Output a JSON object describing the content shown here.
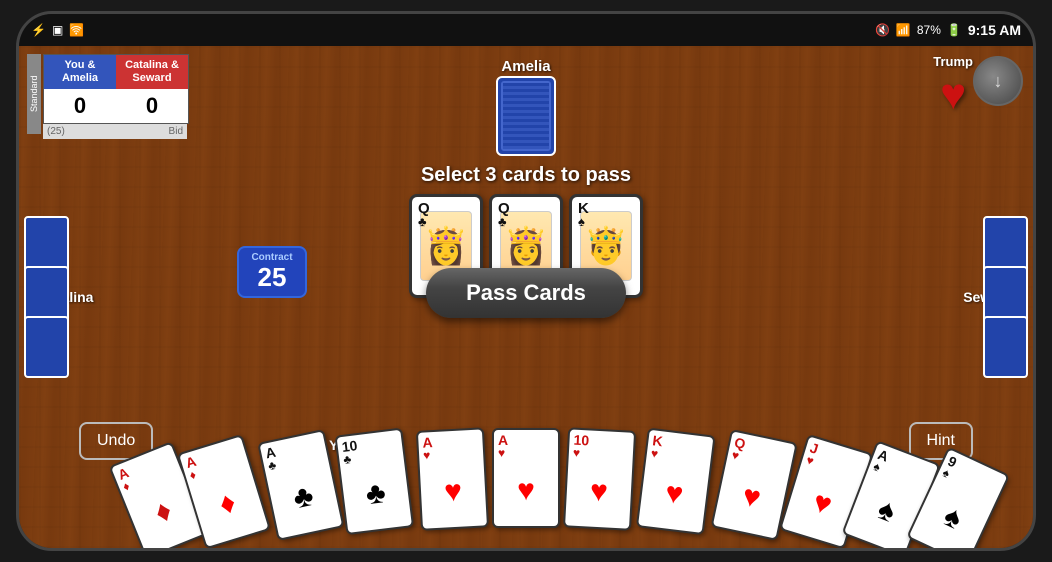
{
  "statusBar": {
    "time": "9:15 AM",
    "battery": "87%",
    "signal": "📶"
  },
  "scoreboard": {
    "team1": {
      "name": "You &\nAmelia",
      "score": "0"
    },
    "team2": {
      "name": "Catalina &\nSeward",
      "score": "0"
    },
    "bid": "Bid",
    "points": "(25)",
    "standard_label": "Standard"
  },
  "trump": {
    "label": "Trump",
    "suit": "♥"
  },
  "players": {
    "top": "Amelia",
    "left": "Catalina",
    "right": "Seward",
    "bottom": "You"
  },
  "game": {
    "select_prompt": "Select 3 cards to pass",
    "contract_label": "Contract",
    "contract_number": "25",
    "pass_cards_label": "Pass Cards",
    "undo_label": "Undo",
    "hint_label": "Hint"
  },
  "selectedCards": [
    {
      "rank": "Q",
      "suit": "♣",
      "color": "black",
      "face": "Q"
    },
    {
      "rank": "Q",
      "suit": "♣",
      "color": "black",
      "face": "Q"
    },
    {
      "rank": "K",
      "suit": "♠",
      "color": "black",
      "face": "K"
    }
  ],
  "handCards": [
    {
      "rank": "A",
      "suit": "♦",
      "color": "red"
    },
    {
      "rank": "A",
      "suit": "♦",
      "color": "red"
    },
    {
      "rank": "A",
      "suit": "♣",
      "color": "black"
    },
    {
      "rank": "10",
      "suit": "♣",
      "color": "black"
    },
    {
      "rank": "A",
      "suit": "♥",
      "color": "red"
    },
    {
      "rank": "A",
      "suit": "♥",
      "color": "red"
    },
    {
      "rank": "10",
      "suit": "♥",
      "color": "red"
    },
    {
      "rank": "K",
      "suit": "♥",
      "color": "red"
    },
    {
      "rank": "Q",
      "suit": "♥",
      "color": "red"
    },
    {
      "rank": "J",
      "suit": "♥",
      "color": "red"
    },
    {
      "rank": "A",
      "suit": "♠",
      "color": "black"
    },
    {
      "rank": "9",
      "suit": "♠",
      "color": "black"
    }
  ]
}
